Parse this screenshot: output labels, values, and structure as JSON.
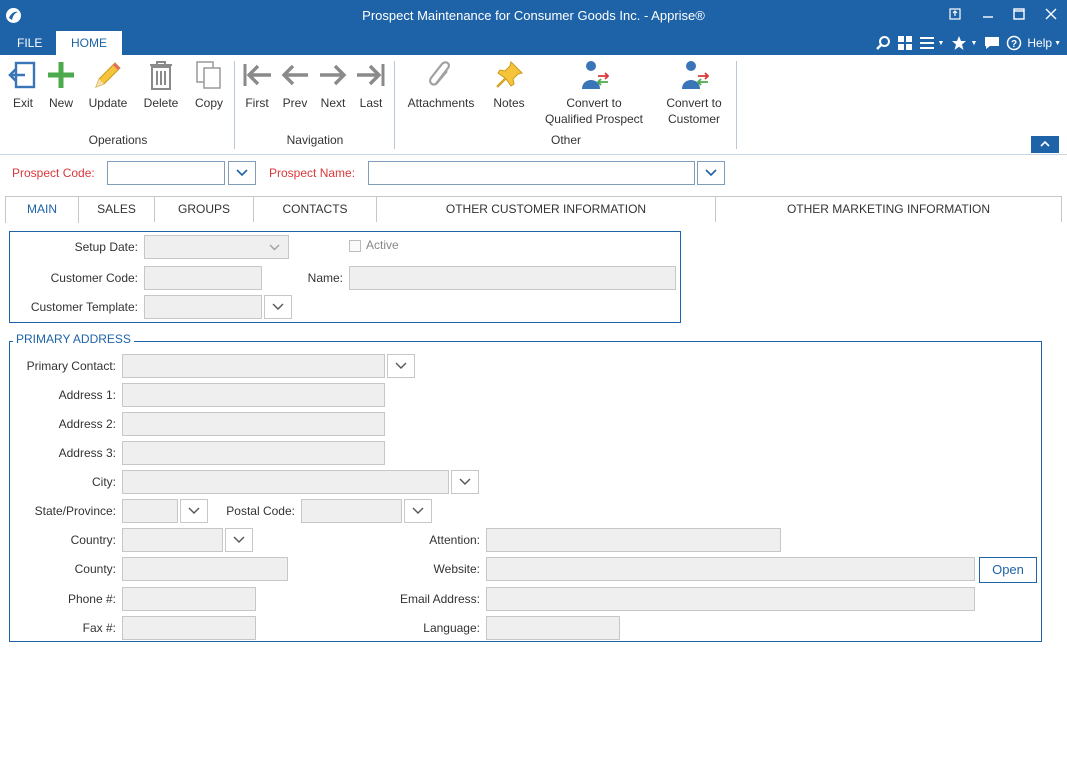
{
  "window": {
    "title": "Prospect Maintenance for Consumer Goods Inc. - Apprise®",
    "icons": [
      "app-logo-icon",
      "restore-window-icon",
      "minimize-icon",
      "maximize-icon",
      "close-icon"
    ]
  },
  "ribbon_tabs": {
    "file": "FILE",
    "home": "HOME"
  },
  "ribbon_right": {
    "help": "Help"
  },
  "ribbon": {
    "operations": {
      "label": "Operations",
      "exit": "Exit",
      "new": "New",
      "update": "Update",
      "delete": "Delete",
      "copy": "Copy"
    },
    "navigation": {
      "label": "Navigation",
      "first": "First",
      "prev": "Prev",
      "next": "Next",
      "last": "Last"
    },
    "other": {
      "label": "Other",
      "attachments": "Attachments",
      "notes": "Notes",
      "convert_qualified_1": "Convert to",
      "convert_qualified_2": "Qualified Prospect",
      "convert_customer_1": "Convert to",
      "convert_customer_2": "Customer"
    }
  },
  "header": {
    "prospect_code_label": "Prospect Code:",
    "prospect_code_value": "",
    "prospect_name_label": "Prospect Name:",
    "prospect_name_value": ""
  },
  "tabs": [
    "MAIN",
    "SALES",
    "GROUPS",
    "CONTACTS",
    "OTHER CUSTOMER INFORMATION",
    "OTHER MARKETING INFORMATION"
  ],
  "main": {
    "setup_date_label": "Setup Date:",
    "active_label": "Active",
    "customer_code_label": "Customer Code:",
    "name_label": "Name:",
    "customer_template_label": "Customer Template:"
  },
  "address": {
    "legend": "PRIMARY ADDRESS",
    "primary_contact_label": "Primary Contact:",
    "address1_label": "Address 1:",
    "address2_label": "Address 2:",
    "address3_label": "Address 3:",
    "city_label": "City:",
    "state_label": "State/Province:",
    "postal_label": "Postal Code:",
    "country_label": "Country:",
    "attention_label": "Attention:",
    "county_label": "County:",
    "website_label": "Website:",
    "open_button": "Open",
    "phone_label": "Phone #:",
    "email_label": "Email Address:",
    "fax_label": "Fax #:",
    "language_label": "Language:"
  },
  "colors": {
    "accent": "#1e63a8",
    "required_label": "#d9383a",
    "field_bg": "#efefef"
  }
}
